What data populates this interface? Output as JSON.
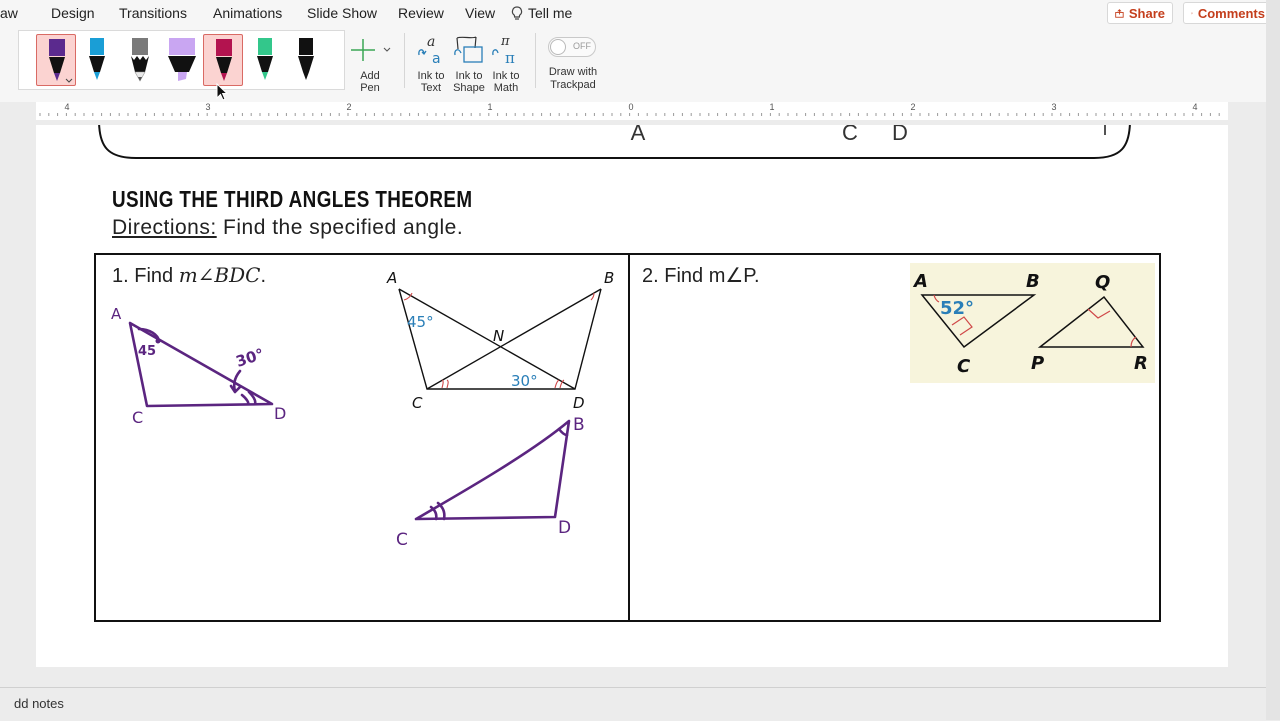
{
  "menu": {
    "tabs": [
      "aw",
      "Design",
      "Transitions",
      "Animations",
      "Slide Show",
      "Review",
      "View"
    ],
    "tell_me": "Tell me",
    "share": "Share",
    "comments": "Comments"
  },
  "ribbon": {
    "add_pen": "Add Pen",
    "ink_to_text": [
      "Ink to",
      "Text"
    ],
    "ink_to_shape": [
      "Ink to",
      "Shape"
    ],
    "ink_to_math": [
      "Ink to",
      "Math"
    ],
    "toggle_state": "OFF",
    "draw_with_trackpad": [
      "Draw with",
      "Trackpad"
    ],
    "pens": [
      {
        "color": "#5b2a8e",
        "type": "pen",
        "selected": true
      },
      {
        "color": "#1a9ed6",
        "type": "pen",
        "selected": false
      },
      {
        "color": "#7a7a7a",
        "type": "pencil",
        "selected": false
      },
      {
        "color": "#c9a6f2",
        "type": "highlighter",
        "selected": false
      },
      {
        "color": "#b3134f",
        "type": "pen",
        "selected": true
      },
      {
        "color": "#33c78b",
        "type": "pen",
        "selected": false
      },
      {
        "color": "#111111",
        "type": "pen",
        "selected": false
      }
    ]
  },
  "ruler": {
    "numbers": [
      "4",
      "3",
      "2",
      "1",
      "0",
      "1",
      "2",
      "3",
      "4"
    ]
  },
  "slide": {
    "top_box_letters": [
      "A",
      "C",
      "D",
      "I"
    ],
    "title": "USING THE THIRD ANGLES THEOREM",
    "directions_label": "Directions:",
    "directions_text": " Find the specified angle.",
    "q1_prefix": "1. Find ",
    "q1_math": "m∠BDC",
    "q1_suffix": ".",
    "q2": "2. Find m∠P.",
    "fig1": {
      "A": "A",
      "B": "B",
      "C": "C",
      "D": "D",
      "N": "N",
      "angle_a": "45°",
      "angle_d": "30°"
    },
    "hand1": {
      "A": "A",
      "C": "C",
      "D": "D",
      "a45": "45",
      "a30": "30°"
    },
    "hand2": {
      "B": "B",
      "C": "C",
      "D": "D"
    },
    "fig2": {
      "A": "A",
      "B": "B",
      "C": "C",
      "Q": "Q",
      "P": "P",
      "R": "R",
      "angle": "52°"
    }
  },
  "notes": {
    "placeholder": "dd notes"
  },
  "colors": {
    "accent": "#c43e1c",
    "ink": "#5b2580",
    "figure_blue": "#2a7fb8",
    "figure_bg": "#f7f4dc"
  }
}
